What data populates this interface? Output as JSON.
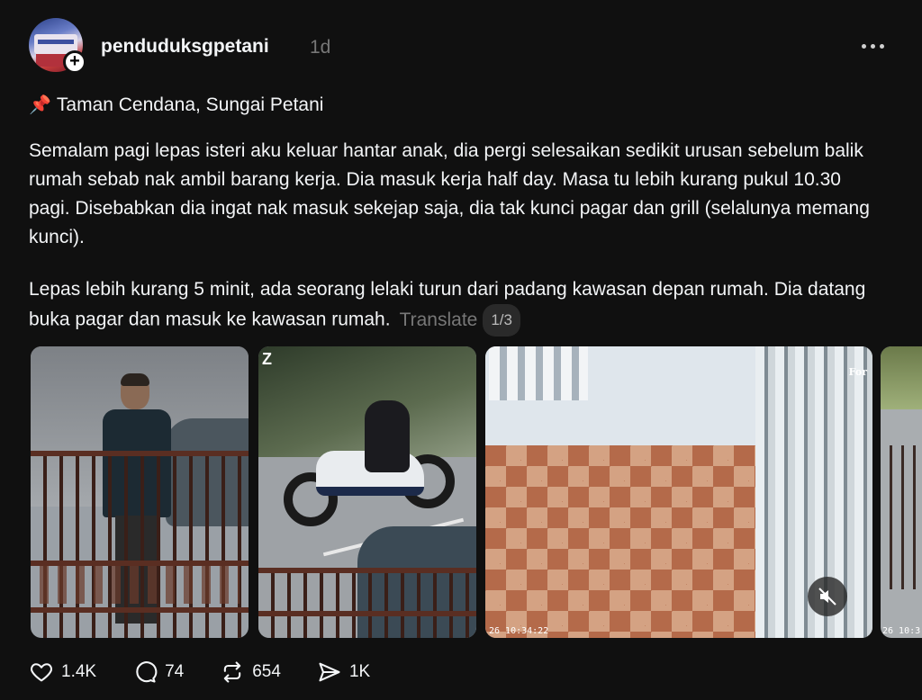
{
  "post": {
    "username": "penduduksgpetani",
    "time": "1d",
    "location_pin_icon": "pushpin-icon",
    "location": "Taman Cendana, Sungai Petani",
    "paragraph1": "Semalam pagi lepas isteri aku keluar hantar anak, dia pergi selesaikan sedikit urusan sebelum balik rumah sebab nak ambil barang kerja. Dia masuk kerja half day. Masa tu lebih kurang pukul 10.30 pagi. Disebabkan dia ingat nak masuk sekejap saja, dia tak kunci pagar dan grill (selalunya memang kunci).",
    "paragraph2": "Lepas lebih kurang 5 minit, ada seorang lelaki turun dari padang kawasan depan rumah. Dia datang buka pagar dan masuk ke kawasan rumah.",
    "translate_label": "Translate",
    "page_indicator": "1/3"
  },
  "media": {
    "image2_label": "Z",
    "image3_timestamp": "26 10:34:22",
    "image3_corner_text": "For",
    "image4_timestamp": "26 10:3"
  },
  "actions": {
    "likes": "1.4K",
    "comments": "74",
    "reposts": "654",
    "shares": "1K"
  }
}
